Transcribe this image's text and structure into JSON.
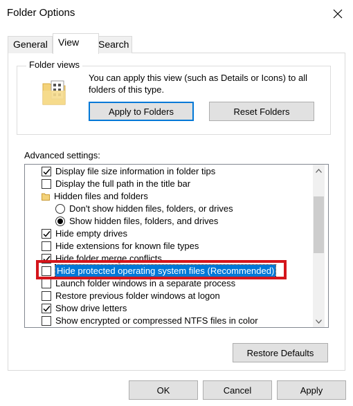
{
  "window": {
    "title": "Folder Options"
  },
  "tabs": [
    {
      "label": "General"
    },
    {
      "label": "View"
    },
    {
      "label": "Search"
    }
  ],
  "folder_views": {
    "legend": "Folder views",
    "description": "You can apply this view (such as Details or Icons) to all folders of this type.",
    "apply_label": "Apply to Folders",
    "reset_label": "Reset Folders"
  },
  "advanced": {
    "label": "Advanced settings:",
    "items": [
      {
        "label": "Display file size information in folder tips",
        "type": "checkbox",
        "checked": true
      },
      {
        "label": "Display the full path in the title bar",
        "type": "checkbox",
        "checked": false
      },
      {
        "label": "Hidden files and folders",
        "type": "folder"
      },
      {
        "label": "Don't show hidden files, folders, or drives",
        "type": "radio",
        "checked": false
      },
      {
        "label": "Show hidden files, folders, and drives",
        "type": "radio",
        "checked": true
      },
      {
        "label": "Hide empty drives",
        "type": "checkbox",
        "checked": true
      },
      {
        "label": "Hide extensions for known file types",
        "type": "checkbox",
        "checked": false
      },
      {
        "label": "Hide folder merge conflicts",
        "type": "checkbox",
        "checked": true
      },
      {
        "label": "Hide protected operating system files (Recommended)",
        "type": "checkbox",
        "checked": false,
        "selected": true
      },
      {
        "label": "Launch folder windows in a separate process",
        "type": "checkbox",
        "checked": false
      },
      {
        "label": "Restore previous folder windows at logon",
        "type": "checkbox",
        "checked": false
      },
      {
        "label": "Show drive letters",
        "type": "checkbox",
        "checked": true
      },
      {
        "label": "Show encrypted or compressed NTFS files in color",
        "type": "checkbox",
        "checked": false
      }
    ]
  },
  "buttons": {
    "restore_defaults": "Restore Defaults",
    "ok": "OK",
    "cancel": "Cancel",
    "apply": "Apply"
  },
  "colors": {
    "accent": "#0078d7",
    "highlight_outline": "#d4151b"
  }
}
